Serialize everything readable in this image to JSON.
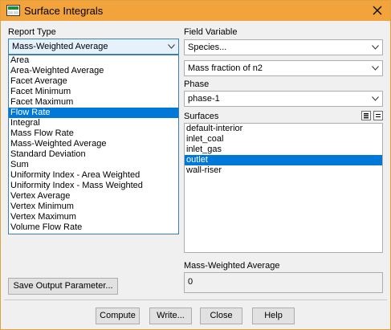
{
  "window": {
    "title": "Surface Integrals"
  },
  "report_type": {
    "label": "Report Type",
    "selected": "Mass-Weighted Average",
    "options": [
      "Area",
      "Area-Weighted Average",
      "Facet Average",
      "Facet Minimum",
      "Facet Maximum",
      "Flow Rate",
      "Integral",
      "Mass Flow Rate",
      "Mass-Weighted Average",
      "Standard Deviation",
      "Sum",
      "Uniformity Index - Area Weighted",
      "Uniformity Index - Mass Weighted",
      "Vertex Average",
      "Vertex Minimum",
      "Vertex Maximum",
      "Volume Flow Rate"
    ],
    "highlighted": "Flow Rate"
  },
  "field_variable": {
    "label": "Field Variable",
    "category": "Species...",
    "variable": "Mass fraction of n2"
  },
  "phase": {
    "label": "Phase",
    "value": "phase-1"
  },
  "surfaces": {
    "label": "Surfaces",
    "items": [
      "default-interior",
      "inlet_coal",
      "inlet_gas",
      "outlet",
      "wall-riser"
    ],
    "selected": "outlet"
  },
  "result": {
    "label": "Mass-Weighted Average",
    "value": "0"
  },
  "buttons": {
    "save_output": "Save Output Parameter...",
    "compute": "Compute",
    "write": "Write...",
    "close": "Close",
    "help": "Help"
  },
  "colors": {
    "titlebar": "#f2a33c",
    "selection": "#0078d7"
  }
}
